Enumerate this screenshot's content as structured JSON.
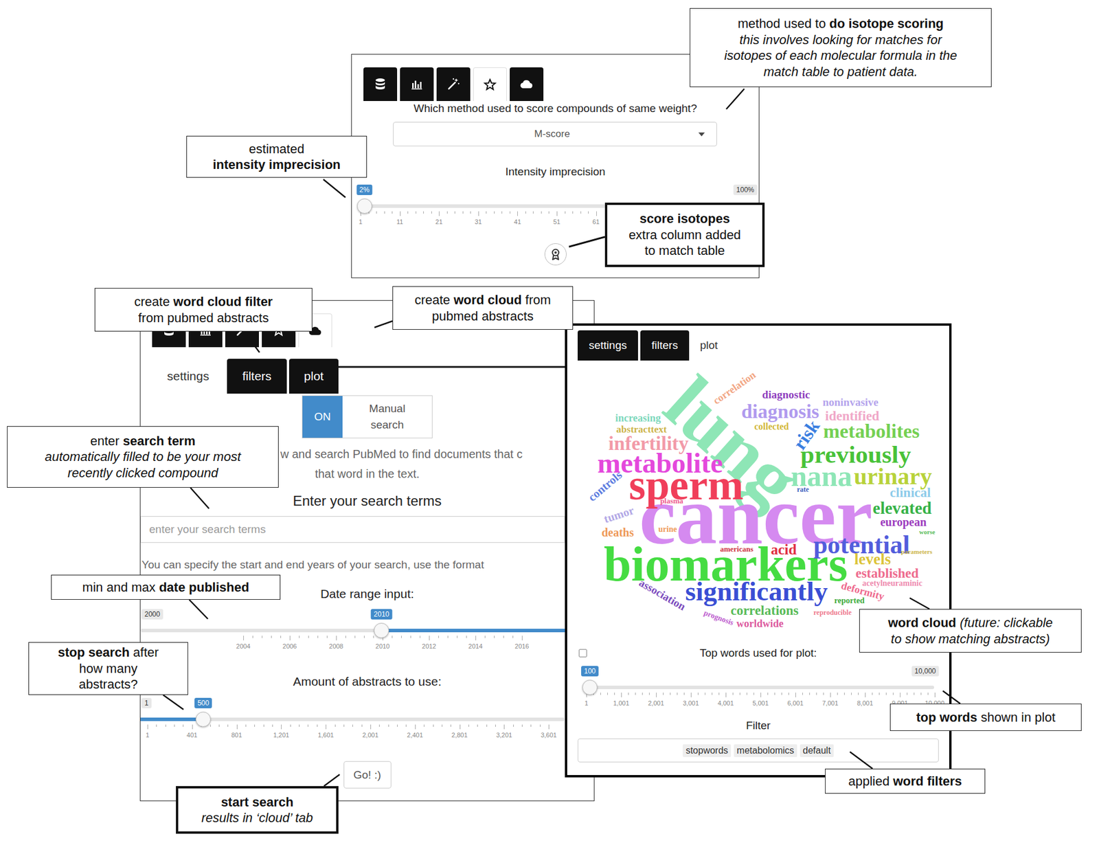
{
  "isotope_panel": {
    "tabs": [
      {
        "kind": "database",
        "selected": false
      },
      {
        "kind": "chart",
        "selected": false
      },
      {
        "kind": "wand",
        "selected": false
      },
      {
        "kind": "star",
        "selected": true
      },
      {
        "kind": "cloud",
        "selected": false
      }
    ],
    "question": "Which method used to score compounds of same weight?",
    "dropdown": {
      "value": "M-score"
    },
    "slider": {
      "label": "Intensity imprecision",
      "kind": "single",
      "value": "2%",
      "max": "100%",
      "level": 0.01,
      "ticks": [
        "1",
        "11",
        "21",
        "31",
        "41",
        "51",
        "61"
      ]
    }
  },
  "search_panel": {
    "tabs": [
      {
        "kind": "database",
        "selected": false
      },
      {
        "kind": "chart",
        "selected": false
      },
      {
        "kind": "wand",
        "selected": false
      },
      {
        "kind": "star",
        "selected": false
      },
      {
        "kind": "cloud",
        "selected": true
      }
    ],
    "subtabs": [
      {
        "label": "settings",
        "selected": true
      },
      {
        "label": "filters",
        "selected": false
      },
      {
        "label": "plot",
        "selected": false
      }
    ],
    "toggle": {
      "on_label": "ON",
      "off_label": "Manual search",
      "on": true
    },
    "intro": [
      "w and search PubMed to find documents that c",
      "that word in the text."
    ],
    "search_label": "Enter your search terms",
    "search_placeholder": "enter your search terms",
    "date_hint": "You can specify the start and end years of your search, use the format",
    "date_slider": {
      "label": "Date range input:",
      "kind": "range",
      "min": "2000",
      "value": "2010",
      "level": 0.568,
      "ticks": [
        "2004",
        "2006",
        "2008",
        "2010",
        "2012",
        "2014",
        "2016"
      ]
    },
    "amount_slider": {
      "label": "Amount of abstracts to use:",
      "kind": "single",
      "min": "1",
      "value": "500",
      "level": 0.148,
      "ticks": [
        "1",
        "401",
        "801",
        "1,201",
        "1,601",
        "2,001",
        "2,401",
        "2,801",
        "3,201",
        "3,601"
      ]
    },
    "go_button": "Go! :)"
  },
  "cloud_panel": {
    "subtabs": [
      {
        "label": "settings",
        "selected": false
      },
      {
        "label": "filters",
        "selected": false
      },
      {
        "label": "plot",
        "selected": true
      }
    ],
    "words": [
      {
        "text": "lung",
        "color": "#8ee6b6"
      },
      {
        "text": "cancer",
        "color": "#d58af0"
      },
      {
        "text": "biomarkers",
        "color": "#45dc42"
      },
      {
        "text": "sperm",
        "color": "#f03e5a"
      },
      {
        "text": "metabolite",
        "color": "#e448dc"
      },
      {
        "text": "significantly",
        "color": "#3a4ed4"
      },
      {
        "text": "potential",
        "color": "#525ddc"
      },
      {
        "text": "previously",
        "color": "#48c238"
      },
      {
        "text": "nana",
        "color": "#8ee6b6"
      },
      {
        "text": "urinary",
        "color": "#b8d23a"
      },
      {
        "text": "metabolites",
        "color": "#74d052"
      },
      {
        "text": "diagnosis",
        "color": "#b09aee"
      },
      {
        "text": "infertility",
        "color": "#f29aa8"
      },
      {
        "text": "risk",
        "color": "#3a7ee0"
      },
      {
        "text": "elevated",
        "color": "#36b247"
      },
      {
        "text": "clinical",
        "color": "#8ccbea"
      },
      {
        "text": "european",
        "color": "#9c3cbe"
      },
      {
        "text": "levels",
        "color": "#dcc43a"
      },
      {
        "text": "established",
        "color": "#ee6a8e"
      },
      {
        "text": "acid",
        "color": "#e02e40"
      },
      {
        "text": "diagnostic",
        "color": "#8e3ebe"
      },
      {
        "text": "identified",
        "color": "#f0a8c8"
      },
      {
        "text": "noninvasive",
        "color": "#b4a4ec"
      },
      {
        "text": "correlation",
        "color": "#f2a684"
      },
      {
        "text": "controls",
        "color": "#5c7ce0"
      },
      {
        "text": "tumor",
        "color": "#b2a8e6"
      },
      {
        "text": "deaths",
        "color": "#ee9a58"
      },
      {
        "text": "urine",
        "color": "#ee9a58"
      },
      {
        "text": "plasma",
        "color": "#ee5a8c"
      },
      {
        "text": "americans",
        "color": "#cc2e3e"
      },
      {
        "text": "correlations",
        "color": "#58bb58"
      },
      {
        "text": "deformity",
        "color": "#ee6a8e"
      },
      {
        "text": "reported",
        "color": "#3aaa3a"
      },
      {
        "text": "reproducible",
        "color": "#ee7a8e"
      },
      {
        "text": "worldwide",
        "color": "#dc5a9e"
      },
      {
        "text": "association",
        "color": "#7c4cbe"
      },
      {
        "text": "prognosis",
        "color": "#bc5ace"
      },
      {
        "text": "acetylneuraminic",
        "color": "#ee8aae"
      },
      {
        "text": "collected",
        "color": "#d2b83a"
      },
      {
        "text": "increasing",
        "color": "#7ed8bc"
      },
      {
        "text": "abstracttext",
        "color": "#ccb44a"
      },
      {
        "text": "rate",
        "color": "#3c5cbe"
      },
      {
        "text": "worse",
        "color": "#58bb58"
      },
      {
        "text": "parameters",
        "color": "#ccb44a"
      }
    ],
    "checkbox": {
      "checked": false
    },
    "top_words_slider": {
      "label": "Top words used for plot:",
      "kind": "single",
      "value": "100",
      "max": "10,000",
      "level": 0.01,
      "ticks": [
        "1",
        "1,001",
        "2,001",
        "3,001",
        "4,001",
        "5,001",
        "6,001",
        "7,001",
        "8,001",
        "9,001",
        "10,000"
      ]
    },
    "filter_label": "Filter",
    "filters": [
      "stopwords",
      "metabolomics",
      "default"
    ]
  },
  "callouts": [
    {
      "kind": "thin",
      "lines": [
        [
          {
            "text": "method used to ",
            "style": "normal"
          },
          {
            "text": "do isotope scoring",
            "style": "bold"
          }
        ],
        [
          {
            "text": "this involves looking for matches for",
            "style": "italic"
          }
        ],
        [
          {
            "text": "isotopes of each molecular formula in the",
            "style": "italic"
          }
        ],
        [
          {
            "text": "match table to patient data.",
            "style": "italic"
          }
        ]
      ]
    },
    {
      "kind": "thin",
      "lines": [
        [
          {
            "text": "estimated",
            "style": "normal"
          }
        ],
        [
          {
            "text": "intensity imprecision",
            "style": "bold"
          }
        ]
      ]
    },
    {
      "kind": "thick",
      "lines": [
        [
          {
            "text": "score isotopes",
            "style": "bold"
          }
        ],
        [
          {
            "text": "extra column added",
            "style": "normal"
          }
        ],
        [
          {
            "text": "to match table",
            "style": "normal"
          }
        ]
      ]
    },
    {
      "kind": "thin",
      "lines": [
        [
          {
            "text": "create ",
            "style": "normal"
          },
          {
            "text": "word cloud filter",
            "style": "bold"
          }
        ],
        [
          {
            "text": "from pubmed abstracts",
            "style": "normal"
          }
        ]
      ]
    },
    {
      "kind": "thin",
      "lines": [
        [
          {
            "text": "create ",
            "style": "normal"
          },
          {
            "text": "word cloud",
            "style": "bold"
          },
          {
            "text": " from",
            "style": "normal"
          }
        ],
        [
          {
            "text": "pubmed abstracts",
            "style": "normal"
          }
        ]
      ]
    },
    {
      "kind": "thin",
      "lines": [
        [
          {
            "text": "enter ",
            "style": "normal"
          },
          {
            "text": "search term",
            "style": "bold"
          }
        ],
        [
          {
            "text": "automatically filled to be your most",
            "style": "italic"
          }
        ],
        [
          {
            "text": "recently clicked compound",
            "style": "italic"
          }
        ]
      ]
    },
    {
      "kind": "thin",
      "lines": [
        [
          {
            "text": "min and max ",
            "style": "normal"
          },
          {
            "text": "date published",
            "style": "bold"
          }
        ]
      ]
    },
    {
      "kind": "thin",
      "lines": [
        [
          {
            "text": "stop search",
            "style": "bold"
          },
          {
            "text": " after",
            "style": "normal"
          }
        ],
        [
          {
            "text": "how many",
            "style": "normal"
          }
        ],
        [
          {
            "text": "abstracts?",
            "style": "normal"
          }
        ]
      ]
    },
    {
      "kind": "thick",
      "lines": [
        [
          {
            "text": "start search",
            "style": "bold"
          }
        ],
        [
          {
            "text": "results in ‘cloud’ tab",
            "style": "italic"
          }
        ]
      ]
    },
    {
      "kind": "thin",
      "lines": [
        [
          {
            "text": "word cloud",
            "style": "bold"
          },
          {
            "text": " (future: clickable",
            "style": "italic"
          }
        ],
        [
          {
            "text": "to show matching abstracts)",
            "style": "italic"
          }
        ]
      ]
    },
    {
      "kind": "thin",
      "lines": [
        [
          {
            "text": "top words",
            "style": "bold"
          },
          {
            "text": " shown in plot",
            "style": "normal"
          }
        ]
      ]
    },
    {
      "kind": "thin",
      "lines": [
        [
          {
            "text": "applied ",
            "style": "normal"
          },
          {
            "text": "word filters",
            "style": "bold"
          }
        ]
      ]
    }
  ]
}
